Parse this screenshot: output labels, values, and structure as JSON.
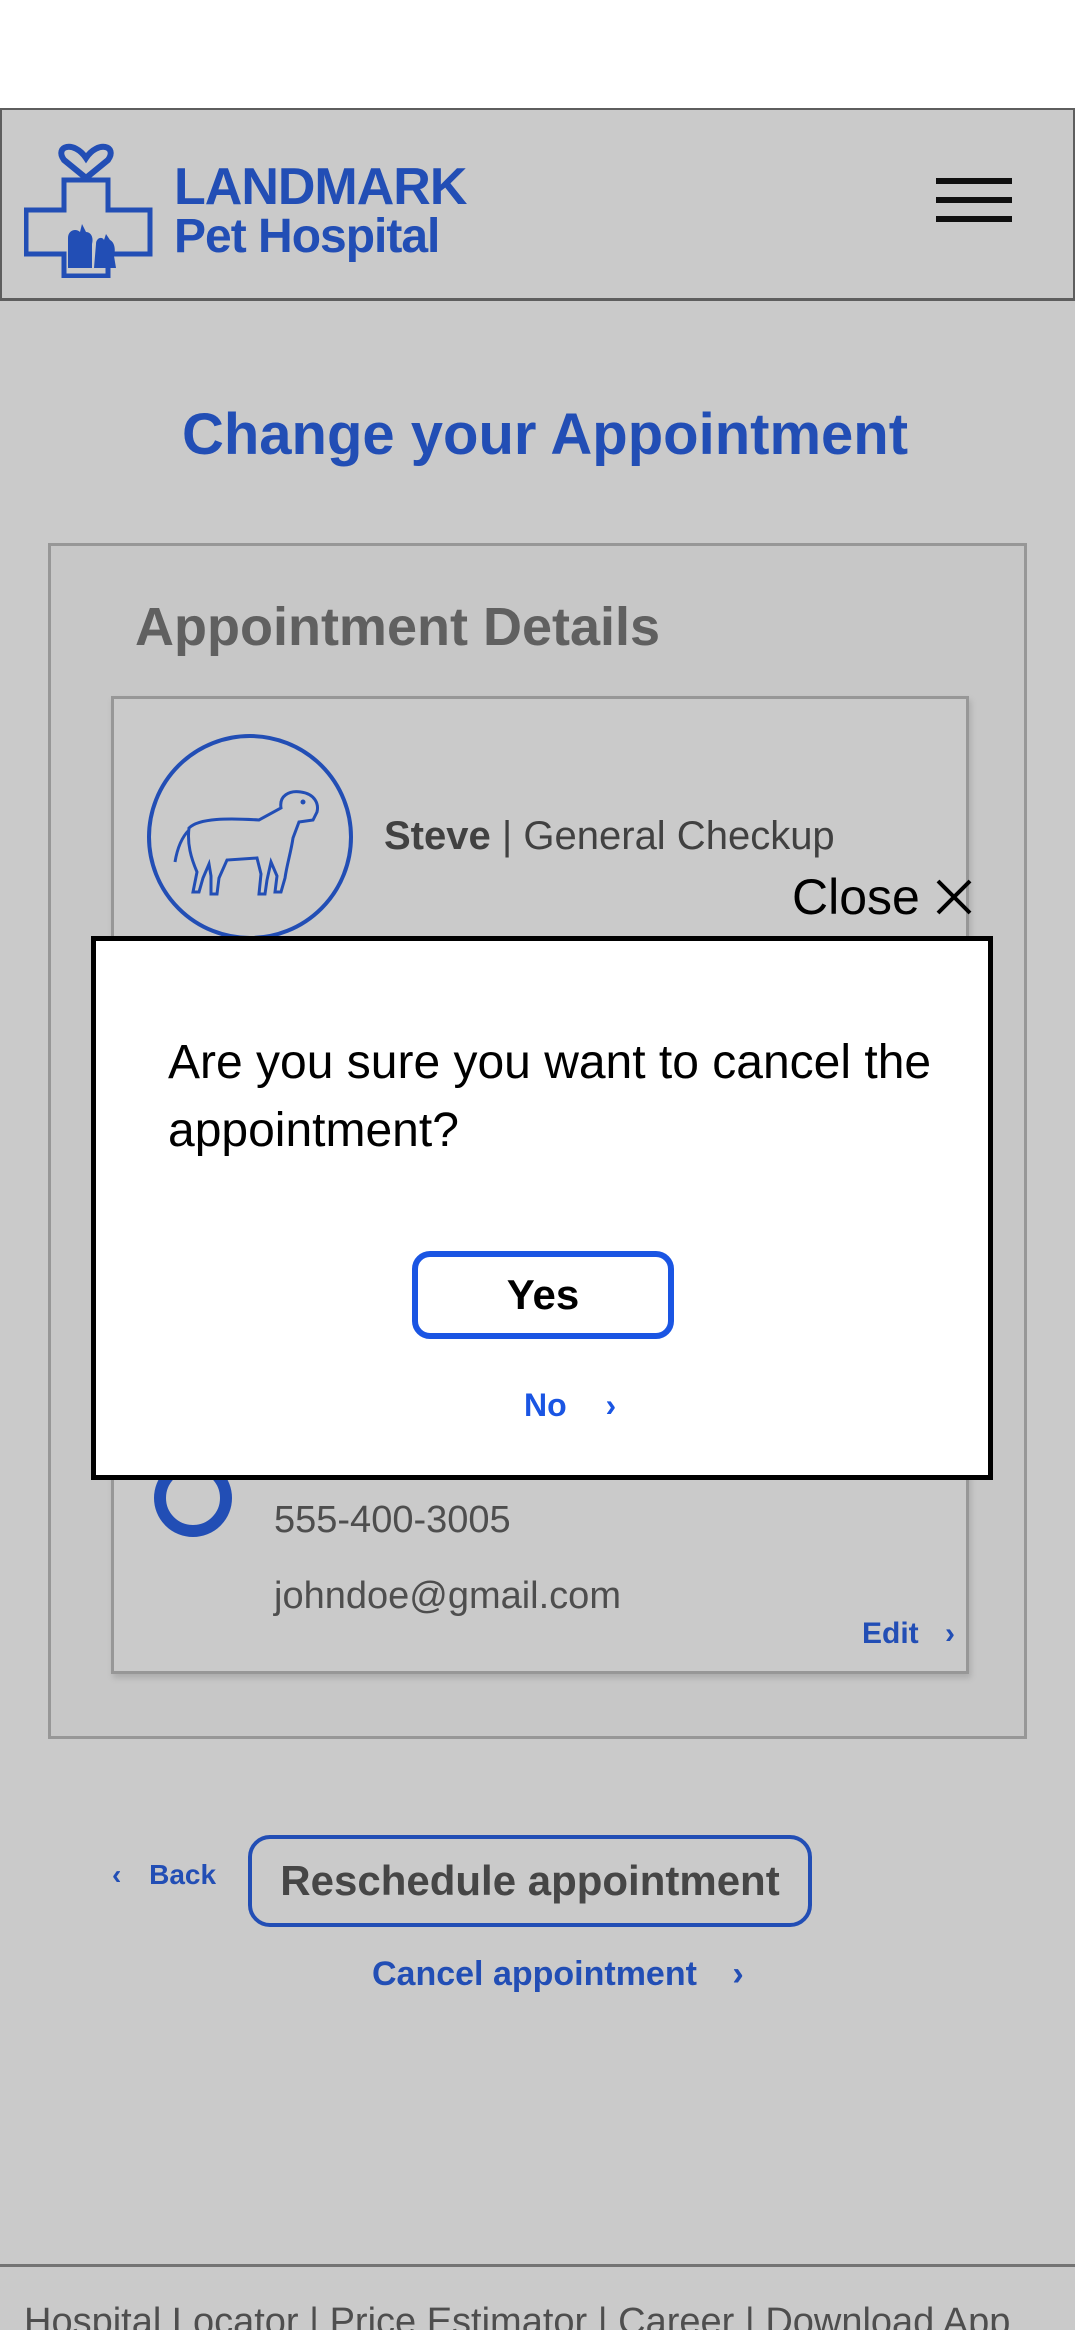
{
  "header": {
    "brand_line1": "LANDMARK",
    "brand_line2": "Pet Hospital",
    "logo_icon": "heart-cross-pets-icon",
    "menu_icon": "hamburger-menu-icon"
  },
  "page": {
    "title": "Change your Appointment"
  },
  "details": {
    "heading": "Appointment Details",
    "pet_name": "Steve",
    "separator": "|",
    "service": "General Checkup",
    "phone": "555-400-3005",
    "email": "johndoe@gmail.com",
    "edit_label": "Edit"
  },
  "actions": {
    "back_label": "Back",
    "reschedule_label": "Reschedule appointment",
    "cancel_label": "Cancel appointment"
  },
  "footer": {
    "links_text": "Hospital Locator  |  Price Estimator  |  Career | Download App"
  },
  "modal": {
    "close_label": "Close",
    "message": "Are you sure you want to cancel the appointment?",
    "yes_label": "Yes",
    "no_label": "No"
  },
  "colors": {
    "brand_blue": "#1a55e3",
    "overlay": "rgba(60,60,60,0.27)"
  }
}
